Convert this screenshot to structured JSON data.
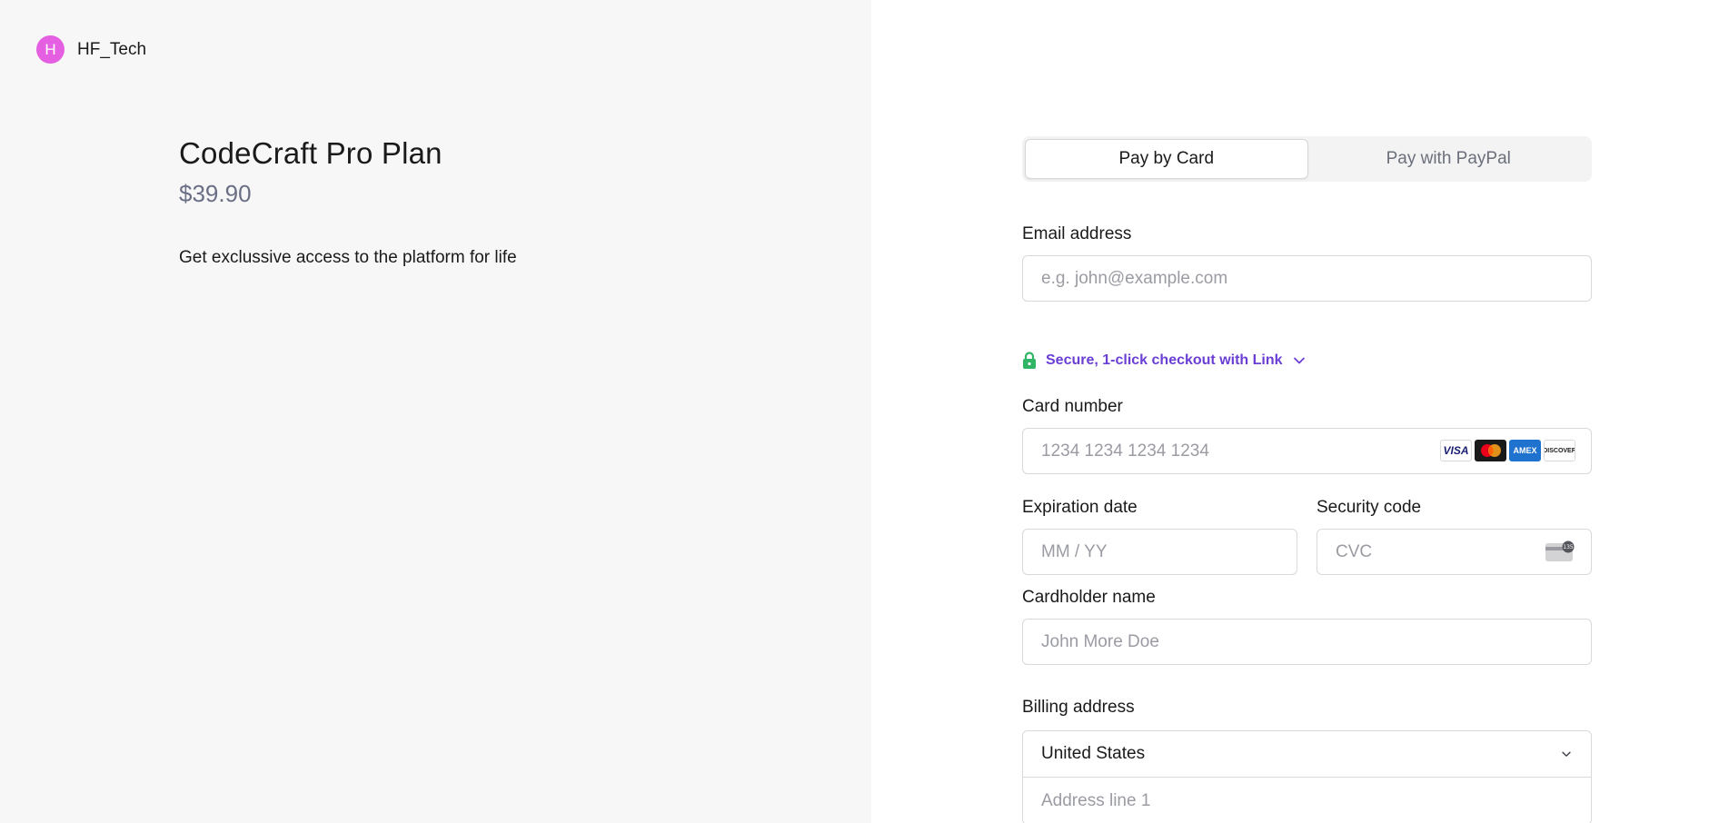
{
  "brand": {
    "initial": "H",
    "name": "HF_Tech",
    "avatar_color": "#e45fe1"
  },
  "product": {
    "title": "CodeCraft Pro Plan",
    "price": "$39.90",
    "description": "Get exclussive access to the platform for life"
  },
  "tabs": [
    {
      "label": "Pay by Card",
      "active": true
    },
    {
      "label": "Pay with PayPal",
      "active": false
    }
  ],
  "email": {
    "label": "Email address",
    "placeholder": "e.g. john@example.com"
  },
  "link": {
    "text": "Secure, 1-click checkout with Link",
    "lock_icon": "lock-icon",
    "lock_color": "#30b566",
    "text_color": "#6b3fd4"
  },
  "card": {
    "label": "Card number",
    "placeholder": "1234 1234 1234 1234",
    "brands": [
      "VISA",
      "mastercard",
      "AMEX",
      "DISCOVER"
    ]
  },
  "expiry": {
    "label": "Expiration date",
    "placeholder": "MM / YY"
  },
  "cvc": {
    "label": "Security code",
    "placeholder": "CVC",
    "icon_text": "135"
  },
  "cardholder": {
    "label": "Cardholder name",
    "placeholder": "John More Doe"
  },
  "billing": {
    "label": "Billing address",
    "country": "United States",
    "address_placeholder": "Address line 1"
  }
}
